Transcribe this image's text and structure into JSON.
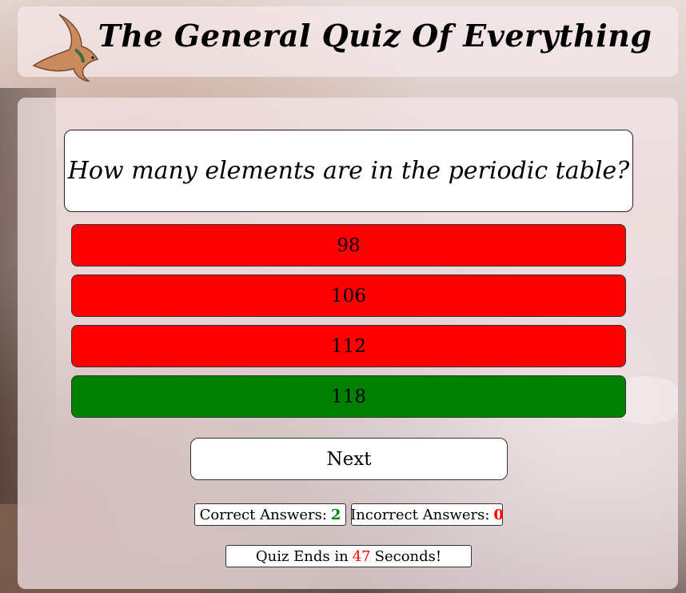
{
  "header": {
    "title": "The General Quiz Of Everything",
    "logo_icon": "bird-icon"
  },
  "question": {
    "text": "How many elements are in the periodic table?"
  },
  "answers": [
    {
      "label": "98",
      "state": "wrong",
      "color": "#ff0000"
    },
    {
      "label": "106",
      "state": "wrong",
      "color": "#ff0000"
    },
    {
      "label": "112",
      "state": "wrong",
      "color": "#ff0000"
    },
    {
      "label": "118",
      "state": "correct",
      "color": "#008000"
    }
  ],
  "next_label": "Next",
  "score": {
    "correct_label": "Correct Answers:",
    "correct_value": "2",
    "incorrect_label": "Incorrect Answers:",
    "incorrect_value": "0"
  },
  "timer": {
    "prefix": "Quiz Ends in",
    "value": "47",
    "suffix": "Seconds!"
  }
}
